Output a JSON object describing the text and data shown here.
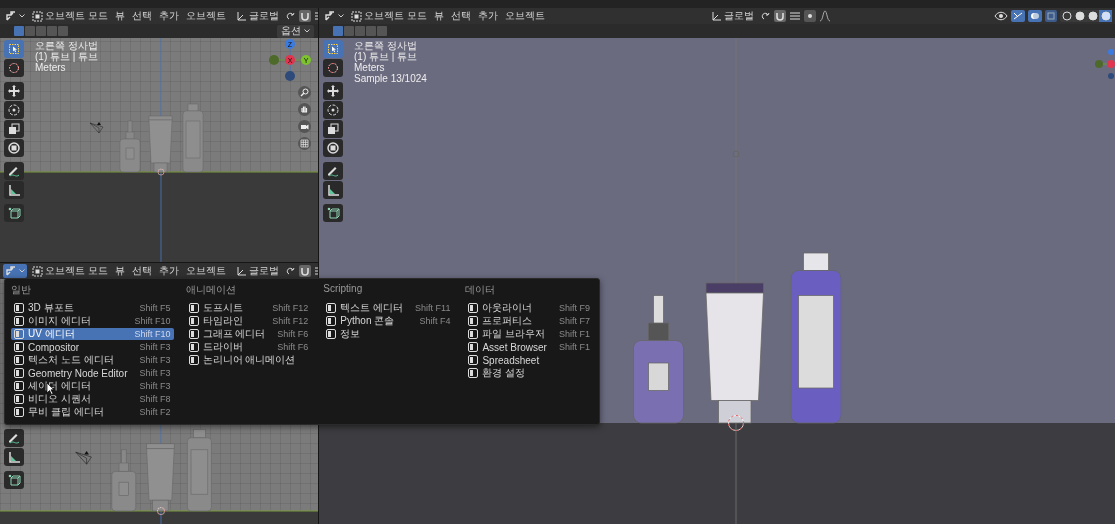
{
  "areas": [
    {
      "header": {
        "mode": "오브젝트 모드",
        "menus": [
          "뷰",
          "선택",
          "추가",
          "오브젝트"
        ],
        "orientation": "글로벌"
      },
      "select_modes": [
        {
          "selected": true
        },
        {
          "selected": false
        },
        {
          "selected": false
        },
        {
          "selected": false
        },
        {
          "selected": false
        }
      ],
      "options": "옵션",
      "overlay": [
        "오른쪽 정사법",
        "(1) 튜브 | 튜브",
        "Meters"
      ],
      "gizmo": [
        "Z",
        "X",
        "Y"
      ],
      "tools": [
        {
          "kind": "select",
          "selected": true
        },
        {
          "kind": "cursor",
          "selected": false
        },
        {
          "kind": "move",
          "selected": false
        },
        {
          "kind": "rotate",
          "selected": false
        },
        {
          "kind": "scale",
          "selected": false
        },
        {
          "kind": "transform",
          "selected": false
        },
        {
          "kind": "annotate",
          "selected": false
        },
        {
          "kind": "measure",
          "selected": false
        },
        {
          "kind": "add_cube",
          "selected": false
        }
      ]
    },
    {
      "header": {
        "mode": "오브젝트 모드",
        "menus": [
          "뷰",
          "선택",
          "추가",
          "오브젝트"
        ],
        "orientation": "글로벌"
      },
      "tools": [
        {
          "kind": "annotate",
          "selected": false
        },
        {
          "kind": "measure",
          "selected": false
        },
        {
          "kind": "add_cube",
          "selected": false
        }
      ]
    },
    {
      "header": {
        "mode": "오브젝트 모드",
        "menus": [
          "뷰",
          "선택",
          "추가",
          "오브젝트"
        ],
        "orientation": "글로벌"
      },
      "select_modes": [
        {
          "selected": true
        },
        {
          "selected": false
        },
        {
          "selected": false
        },
        {
          "selected": false
        },
        {
          "selected": false
        }
      ],
      "shading_modes": [
        {
          "selected": false
        },
        {
          "selected": false
        },
        {
          "selected": false
        },
        {
          "selected": true
        }
      ],
      "overlay": [
        "오른쪽 정사법",
        "(1) 튜브 | 튜브",
        "Meters",
        "Sample 13/1024"
      ],
      "tools": [
        {
          "kind": "select",
          "selected": true
        },
        {
          "kind": "cursor",
          "selected": false
        },
        {
          "kind": "move",
          "selected": false
        },
        {
          "kind": "rotate",
          "selected": false
        },
        {
          "kind": "scale",
          "selected": false
        },
        {
          "kind": "transform",
          "selected": false
        },
        {
          "kind": "annotate",
          "selected": false
        },
        {
          "kind": "measure",
          "selected": false
        },
        {
          "kind": "add_cube",
          "selected": false
        }
      ]
    }
  ],
  "editor_menu": {
    "columns": [
      {
        "heading": "일반",
        "items": [
          {
            "label": "3D 뷰포트",
            "shortcut": "Shift F5",
            "selected": false
          },
          {
            "label": "이미지 에디터",
            "shortcut": "Shift F10",
            "selected": false
          },
          {
            "label": "UV 에디터",
            "shortcut": "Shift F10",
            "selected": true
          },
          {
            "label": "Compositor",
            "shortcut": "Shift F3",
            "selected": false
          },
          {
            "label": "텍스처 노드 에디터",
            "shortcut": "Shift F3",
            "selected": false
          },
          {
            "label": "Geometry Node Editor",
            "shortcut": "Shift F3",
            "selected": false
          },
          {
            "label": "셰이더 에디터",
            "shortcut": "Shift F3",
            "selected": false
          },
          {
            "label": "비디오 시퀀서",
            "shortcut": "Shift F8",
            "selected": false
          },
          {
            "label": "무비 클립 에디터",
            "shortcut": "Shift F2",
            "selected": false
          }
        ]
      },
      {
        "heading": "애니메이션",
        "items": [
          {
            "label": "도프시트",
            "shortcut": "Shift F12",
            "selected": false
          },
          {
            "label": "타임라인",
            "shortcut": "Shift F12",
            "selected": false
          },
          {
            "label": "그래프 에디터",
            "shortcut": "Shift F6",
            "selected": false
          },
          {
            "label": "드라이버",
            "shortcut": "Shift F6",
            "selected": false
          },
          {
            "label": "논리니어 애니메이션",
            "selected": false
          }
        ]
      },
      {
        "heading": "Scripting",
        "items": [
          {
            "label": "텍스트 에디터",
            "shortcut": "Shift F11",
            "selected": false
          },
          {
            "label": "Python 콘솔",
            "shortcut": "Shift F4",
            "selected": false
          },
          {
            "label": "정보",
            "selected": false
          }
        ]
      },
      {
        "heading": "데이터",
        "items": [
          {
            "label": "아웃라이너",
            "shortcut": "Shift F9",
            "selected": false
          },
          {
            "label": "프로퍼티스",
            "shortcut": "Shift F7",
            "selected": false
          },
          {
            "label": "파일 브라우저",
            "shortcut": "Shift F1",
            "selected": false
          },
          {
            "label": "Asset Browser",
            "shortcut": "Shift F1",
            "selected": false
          },
          {
            "label": "Spreadsheet",
            "selected": false
          },
          {
            "label": "환경 설정",
            "selected": false
          }
        ]
      }
    ]
  }
}
